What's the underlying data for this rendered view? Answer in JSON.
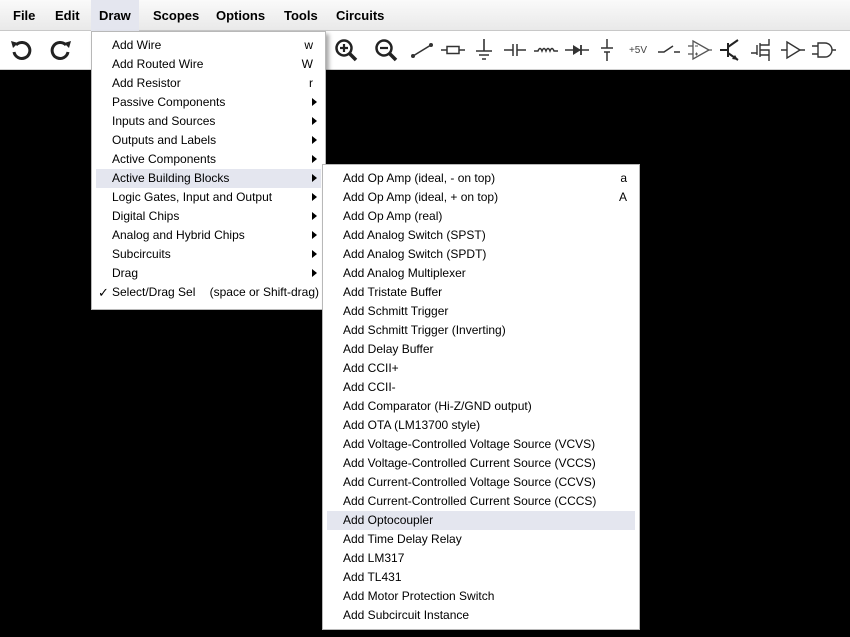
{
  "menubar": {
    "items": [
      "File",
      "Edit",
      "Draw",
      "Scopes",
      "Options",
      "Tools",
      "Circuits"
    ],
    "active": "Draw"
  },
  "toolbar": {
    "icons": [
      "undo-icon",
      "redo-icon",
      "zoom-in-icon",
      "zoom-out-icon",
      "wire-icon",
      "resistor-icon",
      "ground-icon",
      "capacitor-icon",
      "inductor-icon",
      "diode-icon",
      "dc-source-icon",
      "voltage-rail-icon",
      "switch-icon",
      "op-amp-icon",
      "npn-transistor-icon",
      "mosfet-icon",
      "buffer-icon",
      "and-gate-icon"
    ],
    "voltage_rail_label": "+5V"
  },
  "draw_menu": {
    "items": [
      {
        "label": "Add Wire",
        "shortcut": "w",
        "submenu": false
      },
      {
        "label": "Add Routed Wire",
        "shortcut": "W",
        "submenu": false
      },
      {
        "label": "Add Resistor",
        "shortcut": "r",
        "submenu": false
      },
      {
        "label": "Passive Components",
        "shortcut": "",
        "submenu": true
      },
      {
        "label": "Inputs and Sources",
        "shortcut": "",
        "submenu": true
      },
      {
        "label": "Outputs and Labels",
        "shortcut": "",
        "submenu": true
      },
      {
        "label": "Active Components",
        "shortcut": "",
        "submenu": true
      },
      {
        "label": "Active Building Blocks",
        "shortcut": "",
        "submenu": true,
        "highlighted": true
      },
      {
        "label": "Logic Gates, Input and Output",
        "shortcut": "",
        "submenu": true
      },
      {
        "label": "Digital Chips",
        "shortcut": "",
        "submenu": true
      },
      {
        "label": "Analog and Hybrid Chips",
        "shortcut": "",
        "submenu": true
      },
      {
        "label": "Subcircuits",
        "shortcut": "",
        "submenu": true
      },
      {
        "label": "Drag",
        "shortcut": "",
        "submenu": true
      },
      {
        "label": "Select/Drag Sel",
        "shortcut": "(space or Shift-drag)",
        "submenu": false,
        "checked": true,
        "check_mark": "✓"
      }
    ]
  },
  "active_building_blocks_menu": {
    "items": [
      {
        "label": "Add Op Amp (ideal, - on top)",
        "shortcut": "a"
      },
      {
        "label": "Add Op Amp (ideal, + on top)",
        "shortcut": "A"
      },
      {
        "label": "Add Op Amp (real)",
        "shortcut": ""
      },
      {
        "label": "Add Analog Switch (SPST)",
        "shortcut": ""
      },
      {
        "label": "Add Analog Switch (SPDT)",
        "shortcut": ""
      },
      {
        "label": "Add Analog Multiplexer",
        "shortcut": ""
      },
      {
        "label": "Add Tristate Buffer",
        "shortcut": ""
      },
      {
        "label": "Add Schmitt Trigger",
        "shortcut": ""
      },
      {
        "label": "Add Schmitt Trigger (Inverting)",
        "shortcut": ""
      },
      {
        "label": "Add Delay Buffer",
        "shortcut": ""
      },
      {
        "label": "Add CCII+",
        "shortcut": ""
      },
      {
        "label": "Add CCII-",
        "shortcut": ""
      },
      {
        "label": "Add Comparator (Hi-Z/GND output)",
        "shortcut": ""
      },
      {
        "label": "Add OTA (LM13700 style)",
        "shortcut": ""
      },
      {
        "label": "Add Voltage-Controlled Voltage Source (VCVS)",
        "shortcut": ""
      },
      {
        "label": "Add Voltage-Controlled Current Source (VCCS)",
        "shortcut": ""
      },
      {
        "label": "Add Current-Controlled Voltage Source (CCVS)",
        "shortcut": ""
      },
      {
        "label": "Add Current-Controlled Current Source (CCCS)",
        "shortcut": ""
      },
      {
        "label": "Add Optocoupler",
        "shortcut": "",
        "highlighted": true
      },
      {
        "label": "Add Time Delay Relay",
        "shortcut": ""
      },
      {
        "label": "Add LM317",
        "shortcut": ""
      },
      {
        "label": "Add TL431",
        "shortcut": ""
      },
      {
        "label": "Add Motor Protection Switch",
        "shortcut": ""
      },
      {
        "label": "Add Subcircuit Instance",
        "shortcut": ""
      }
    ]
  },
  "colors": {
    "canvas": "#000000",
    "highlight": "#e4e6ef",
    "menubar": "#f0f0f0"
  }
}
